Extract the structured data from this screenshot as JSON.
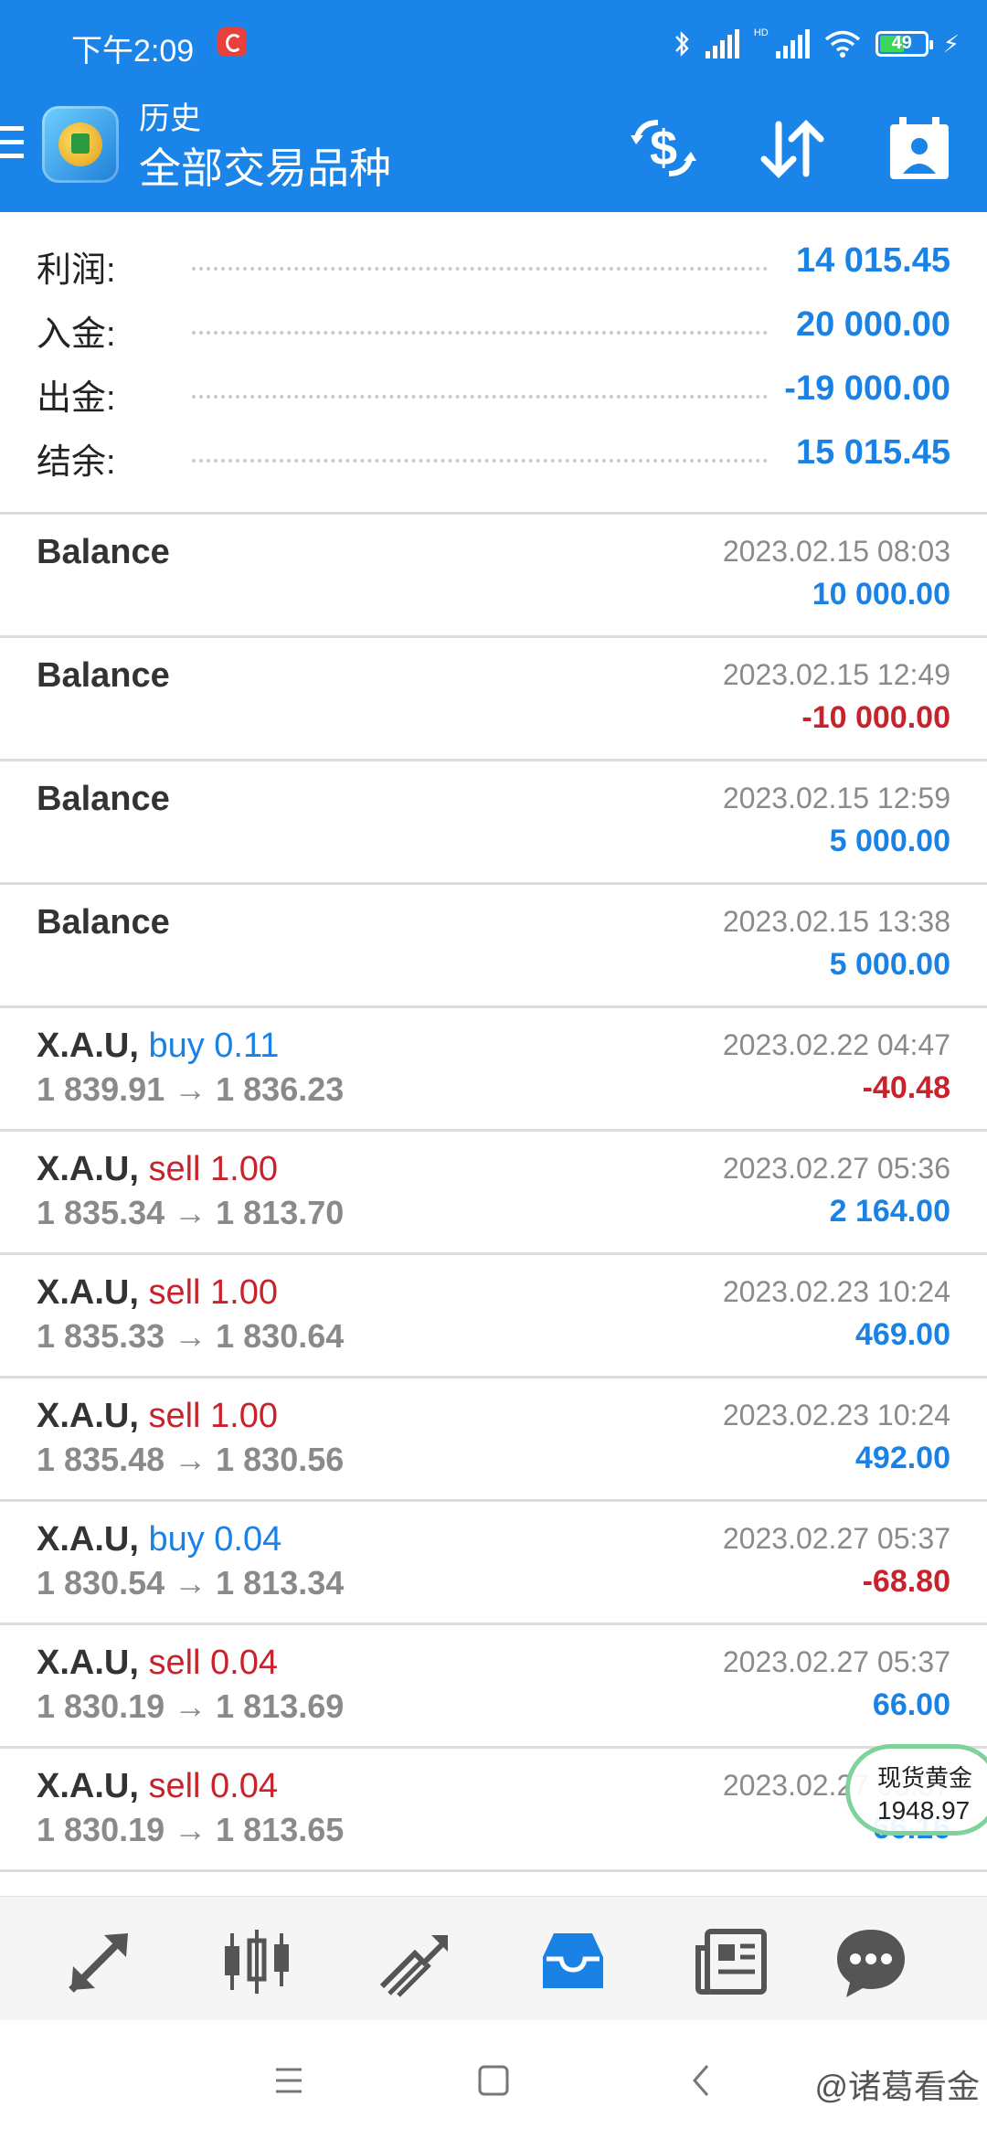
{
  "status_bar": {
    "time": "下午2:09",
    "network_label": "HD",
    "battery": "49",
    "icons": [
      "notification-icon",
      "bluetooth-icon",
      "signal-icon",
      "signal-hd-icon",
      "wifi-icon",
      "battery-icon",
      "charging-icon"
    ]
  },
  "header": {
    "subtitle": "历史",
    "title": "全部交易品种",
    "actions": [
      "deposit-icon",
      "sort-icon",
      "calendar-icon"
    ]
  },
  "summary": [
    {
      "label": "利润:",
      "value": "14 015.45"
    },
    {
      "label": "入金:",
      "value": "20 000.00"
    },
    {
      "label": "出金:",
      "value": "-19 000.00"
    },
    {
      "label": "结余:",
      "value": "15 015.45"
    }
  ],
  "history": [
    {
      "symbol": "Balance",
      "side": "",
      "volume": "",
      "prices": "",
      "date": "2023.02.15 08:03",
      "amount": "10 000.00",
      "amount_color": "blue"
    },
    {
      "symbol": "Balance",
      "side": "",
      "volume": "",
      "prices": "",
      "date": "2023.02.15 12:49",
      "amount": "-10 000.00",
      "amount_color": "red"
    },
    {
      "symbol": "Balance",
      "side": "",
      "volume": "",
      "prices": "",
      "date": "2023.02.15 12:59",
      "amount": "5 000.00",
      "amount_color": "blue"
    },
    {
      "symbol": "Balance",
      "side": "",
      "volume": "",
      "prices": "",
      "date": "2023.02.15 13:38",
      "amount": "5 000.00",
      "amount_color": "blue"
    },
    {
      "symbol": "X.A.U,",
      "side": "buy 0.11",
      "side_color": "blue",
      "prices": "1 839.91 → 1 836.23",
      "date": "2023.02.22 04:47",
      "amount": "-40.48",
      "amount_color": "red"
    },
    {
      "symbol": "X.A.U,",
      "side": "sell 1.00",
      "side_color": "red",
      "prices": "1 835.34 → 1 813.70",
      "date": "2023.02.27 05:36",
      "amount": "2 164.00",
      "amount_color": "blue"
    },
    {
      "symbol": "X.A.U,",
      "side": "sell 1.00",
      "side_color": "red",
      "prices": "1 835.33 → 1 830.64",
      "date": "2023.02.23 10:24",
      "amount": "469.00",
      "amount_color": "blue"
    },
    {
      "symbol": "X.A.U,",
      "side": "sell 1.00",
      "side_color": "red",
      "prices": "1 835.48 → 1 830.56",
      "date": "2023.02.23 10:24",
      "amount": "492.00",
      "amount_color": "blue"
    },
    {
      "symbol": "X.A.U,",
      "side": "buy 0.04",
      "side_color": "blue",
      "prices": "1 830.54 → 1 813.34",
      "date": "2023.02.27 05:37",
      "amount": "-68.80",
      "amount_color": "red"
    },
    {
      "symbol": "X.A.U,",
      "side": "sell 0.04",
      "side_color": "red",
      "prices": "1 830.19 → 1 813.69",
      "date": "2023.02.27 05:37",
      "amount": "66.00",
      "amount_color": "blue"
    },
    {
      "symbol": "X.A.U,",
      "side": "sell 0.04",
      "side_color": "red",
      "prices": "1 830.19 → 1 813.65",
      "date": "2023.02.27 05:37",
      "amount": "66.16",
      "amount_color": "blue"
    }
  ],
  "widget": {
    "name": "现货黄金",
    "value": "1948.97"
  },
  "bottom_nav": [
    "quotes-icon",
    "chart-icon",
    "trade-icon",
    "history-icon",
    "news-icon",
    "chat-icon"
  ],
  "bottom_nav_active": "history-icon",
  "system_nav": [
    "recent-apps-icon",
    "home-icon",
    "back-icon"
  ],
  "watermark": "@诸葛看金",
  "colors": {
    "header_bg": "#1a84e9",
    "profit_blue": "#1b82e5",
    "loss_red": "#c8232c"
  }
}
